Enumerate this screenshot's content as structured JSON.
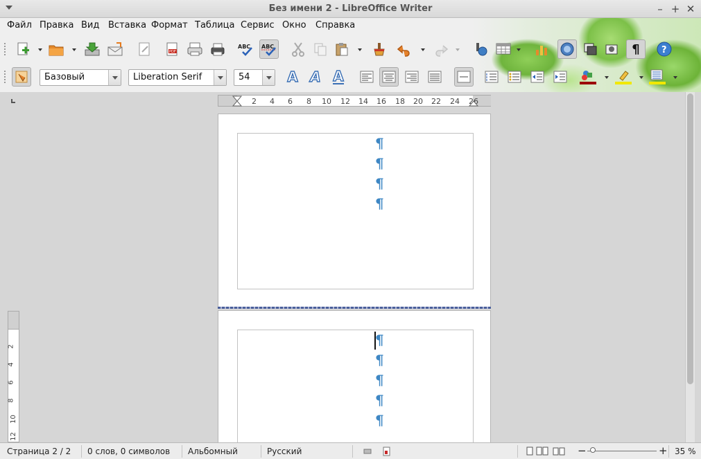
{
  "window": {
    "title": "Без имени 2 - LibreOffice Writer",
    "minimize": "–",
    "maximize": "+",
    "close": "✕"
  },
  "menu": [
    "Файл",
    "Правка",
    "Вид",
    "Вставка",
    "Формат",
    "Таблица",
    "Сервис",
    "Окно",
    "Справка"
  ],
  "format_bar": {
    "paragraph_style": "Базовый",
    "font_name": "Liberation Serif",
    "font_size": "54"
  },
  "ruler": {
    "h_ticks": [
      "2",
      "4",
      "6",
      "8",
      "10",
      "12",
      "14",
      "16",
      "18",
      "20",
      "22",
      "24",
      "26"
    ],
    "v_ticks": [
      "2",
      "4",
      "6",
      "8",
      "10",
      "12"
    ]
  },
  "document": {
    "page1_pilcrow": "¶",
    "page2_pilcrow": "¶"
  },
  "status": {
    "page": "Страница 2 / 2",
    "words": "0 слов, 0 символов",
    "page_style": "Альбомный",
    "language": "Русский",
    "zoom": "35 %",
    "zoom_minus": "−",
    "zoom_plus": "+"
  },
  "colors": {
    "pilcrow": "#3e87c4",
    "font_color_bar": "#9c0a0a",
    "highlight_bar": "#f1e800"
  }
}
